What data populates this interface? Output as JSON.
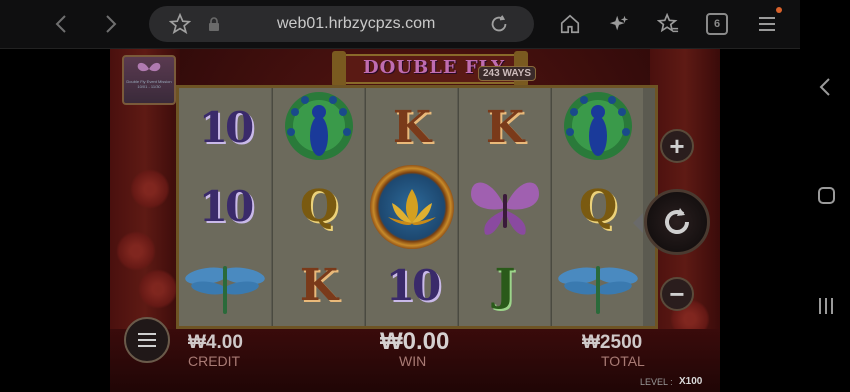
{
  "browser": {
    "url": "web01.hrbzycpzs.com",
    "tab_count": "6"
  },
  "game": {
    "title": "DOUBLE FLY",
    "ways": "243 WAYS",
    "promo_text": "Double Fly Event Mission 10/01 - 11/30",
    "reels": [
      [
        "10",
        "10",
        "dragonfly"
      ],
      [
        "peacock",
        "Q",
        "K"
      ],
      [
        "K",
        "lotus",
        "10"
      ],
      [
        "K",
        "butterfly",
        "J"
      ],
      [
        "peacock",
        "Q",
        "dragonfly"
      ]
    ],
    "credit_value": "₩4.00",
    "credit_label": "CREDIT",
    "win_value": "₩0.00",
    "win_label": "WIN",
    "total_value": "₩2500",
    "total_label": "TOTAL",
    "level_label": "LEVEL :",
    "level_value": "X100",
    "plus_label": "+",
    "minus_label": "−"
  },
  "colors": {
    "game_bg": "#3a0b0b",
    "frame_gold": "#6e5424",
    "accent_pink": "#c06db0"
  },
  "icons": {
    "back": "chevron-left-icon",
    "forward": "chevron-right-icon",
    "bookmark": "star-outline-icon",
    "lock": "lock-icon",
    "reload": "reload-icon",
    "home": "home-icon",
    "sparkle": "sparkle-icon",
    "favorites": "star-list-icon",
    "tabs": "tabs-icon",
    "menu": "hamburger-menu-icon"
  }
}
